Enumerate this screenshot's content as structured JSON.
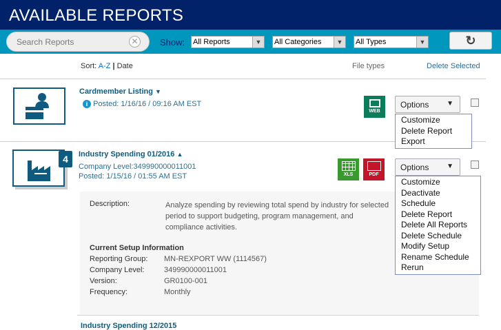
{
  "header": {
    "title": "AVAILABLE REPORTS"
  },
  "toolbar": {
    "search_placeholder": "Search Reports",
    "show_label": "Show:",
    "filters": [
      "All Reports",
      "All Categories",
      "All Types"
    ],
    "refresh_icon": "refresh-icon"
  },
  "list_header": {
    "sort_label": "Sort:",
    "sort_az": "A-Z",
    "sort_sep": "|",
    "sort_date": "Date",
    "file_types": "File types",
    "delete_selected": "Delete Selected"
  },
  "reports": [
    {
      "title": "Cardmember Listing",
      "posted": "Posted: 1/16/16 / 09:16 AM EST",
      "file_types": [
        "WEB"
      ],
      "options_label": "Options",
      "menu": [
        "Customize",
        "Delete Report",
        "Export"
      ]
    },
    {
      "title": "Industry Spending 01/2016",
      "badge": "4",
      "company_level": "Company Level:349990000011001",
      "posted": "Posted: 1/15/16 / 01:55 AM EST",
      "file_types": [
        "XLS",
        "PDF"
      ],
      "options_label": "Options",
      "menu": [
        "Customize",
        "Deactivate Schedule",
        "Delete Report",
        "Delete All Reports",
        "Delete Schedule",
        "Modify Setup",
        "Rename Schedule",
        "Rerun"
      ],
      "detail": {
        "description_label": "Description:",
        "description": "Analyze spending by reviewing total spend by industry for selected period to support budgeting, program management, and compliance activities.",
        "setup_title": "Current Setup Information",
        "fields": [
          {
            "label": "Reporting Group:",
            "value": "MN-REXPORT WW (1114567)"
          },
          {
            "label": "Company Level:",
            "value": "349990000011001"
          },
          {
            "label": "Version:",
            "value": "GR0100-001"
          },
          {
            "label": "Frequency:",
            "value": "Monthly"
          }
        ]
      }
    },
    {
      "title": "Industry Spending 12/2015"
    }
  ],
  "colors": {
    "header": "#012169",
    "toolbar": "#0097bf",
    "web": "#0b7d5b",
    "xls": "#3a9a2f",
    "pdf": "#c4162a"
  }
}
